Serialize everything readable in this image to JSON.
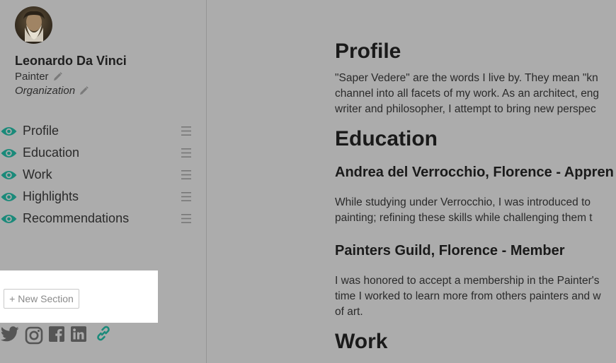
{
  "user": {
    "name": "Leonardo Da Vinci",
    "title": "Painter",
    "organization": "Organization"
  },
  "sidebar": {
    "sections": [
      {
        "label": "Profile"
      },
      {
        "label": "Education"
      },
      {
        "label": "Work"
      },
      {
        "label": "Highlights"
      },
      {
        "label": "Recommendations"
      }
    ],
    "new_section_label": "+ New Section",
    "social": [
      "twitter-icon",
      "instagram-icon",
      "facebook-icon",
      "linkedin-icon",
      "link-icon"
    ]
  },
  "main": {
    "profile": {
      "heading": "Profile",
      "lines": [
        "\"Saper Vedere\" are the words I live by. They mean \"kn",
        "channel into all facets of my work. As an architect, eng",
        "writer and philosopher, I attempt to bring new perspec"
      ]
    },
    "education": {
      "heading": "Education",
      "entries": [
        {
          "title": "Andrea del Verrocchio, Florence - Appren",
          "lines": [
            "While studying under Verrocchio, I was introduced to",
            "painting; refining these skills while challenging them t"
          ]
        },
        {
          "title": "Painters Guild, Florence - Member",
          "lines": [
            "I was honored to accept a membership in the Painter's",
            "time I worked to learn more from others painters and w",
            "of art."
          ]
        }
      ]
    },
    "work": {
      "heading": "Work"
    }
  },
  "colors": {
    "background": "#acacac",
    "accent_teal": "#1a8a7a",
    "text": "#222222",
    "panel_white": "#ffffff"
  }
}
